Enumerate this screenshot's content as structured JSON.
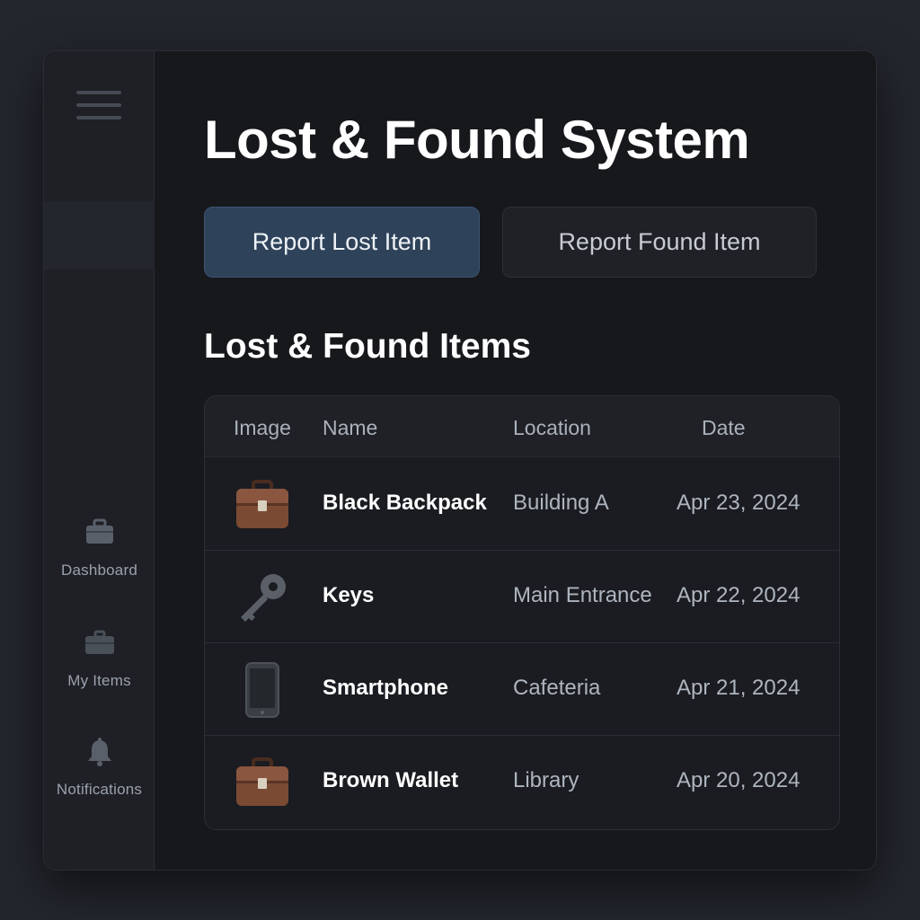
{
  "sidebar": {
    "menu_icon": "hamburger-menu-icon",
    "items": [
      {
        "label": "Dashboard",
        "icon": "briefcase-icon"
      },
      {
        "label": "My Items",
        "icon": "suitcase-icon"
      },
      {
        "label": "Notifications",
        "icon": "bell-icon"
      }
    ]
  },
  "main": {
    "title": "Lost & Found System",
    "buttons": {
      "report_lost": "Report Lost Item",
      "report_found": "Report Found Item"
    },
    "section_title": "Lost & Found Items",
    "table": {
      "columns": [
        "Image",
        "Name",
        "Location",
        "Date"
      ],
      "rows": [
        {
          "image": "briefcase-icon",
          "name": "Black Backpack",
          "location": "Building A",
          "date": "Apr 23, 2024"
        },
        {
          "image": "key-icon",
          "name": "Keys",
          "location": "Main Entrance",
          "date": "Apr 22, 2024"
        },
        {
          "image": "smartphone-icon",
          "name": "Smartphone",
          "location": "Cafeteria",
          "date": "Apr 21, 2024"
        },
        {
          "image": "briefcase-icon",
          "name": "Brown Wallet",
          "location": "Library",
          "date": "Apr 20, 2024"
        }
      ]
    }
  },
  "colors": {
    "background": "#23262d",
    "panel": "#16181c",
    "sidebar": "#1e2026",
    "primary_button": "#2e4259",
    "briefcase_brown": "#7a4a33"
  }
}
